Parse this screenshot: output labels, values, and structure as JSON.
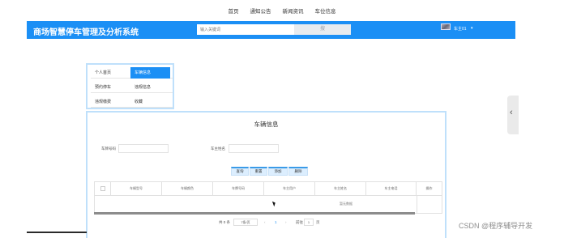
{
  "topnav": {
    "items": [
      "首页",
      "通知公告",
      "新闻资讯",
      "车位信息"
    ]
  },
  "header": {
    "brand": "商场智慧停车管理及分析系统",
    "search_placeholder": "输入关键词",
    "search_button": "搜",
    "user_name": "车主01",
    "caret": "▾",
    "accent": "#1b8ff5"
  },
  "sidemenu": {
    "items": [
      {
        "label": "个人首页",
        "active": false
      },
      {
        "label": "车辆信息",
        "active": true
      },
      {
        "label": "预约停车",
        "active": false
      },
      {
        "label": "违规信息",
        "active": false
      },
      {
        "label": "违规缴费",
        "active": false
      },
      {
        "label": "收藏",
        "active": false
      }
    ]
  },
  "panel": {
    "title": "车辆信息",
    "filters": {
      "plate_label": "车牌号码",
      "owner_label": "车主姓名"
    },
    "buttons": [
      "查询",
      "重置",
      "添加",
      "删除"
    ],
    "columns": [
      "车辆型号",
      "车辆颜色",
      "车牌号码",
      "车主用户",
      "车主姓名",
      "车主电话",
      "操作"
    ],
    "empty_text": "暂无数据",
    "pager": {
      "total": "共 0 条",
      "page_size": "7条/页",
      "prev": "‹",
      "current": "1",
      "next": "›",
      "goto": "前往",
      "goto_page": "1",
      "page_unit": "页"
    }
  },
  "side_tab": {
    "icon": "chevron-left-icon",
    "glyph": "‹"
  },
  "watermark": "CSDN @程序辅导开发"
}
